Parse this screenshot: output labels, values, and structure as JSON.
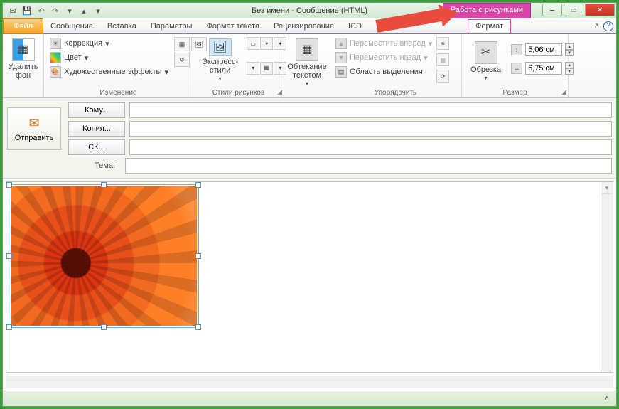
{
  "title": "Без имени  -  Сообщение (HTML)",
  "context_tab": "Работа с рисунками",
  "qat": {
    "icons": [
      "new-mail",
      "save",
      "undo",
      "redo",
      "down",
      "up",
      "more"
    ]
  },
  "win": {
    "min": "–",
    "max": "▭",
    "close": "✕"
  },
  "tabs": {
    "file": "Файл",
    "items": [
      "Сообщение",
      "Вставка",
      "Параметры",
      "Формат текста",
      "Рецензирование",
      "ICD"
    ],
    "format": "Формат",
    "help_chevron": "˄",
    "help_q": "?"
  },
  "ribbon": {
    "remove_bg": {
      "label": "Удалить\nфон"
    },
    "adjust": {
      "corrections": "Коррекция",
      "color": "Цвет",
      "artistic": "Художественные эффекты",
      "group_label": "Изменение"
    },
    "styles": {
      "express": "Экспресс-стили",
      "group_label": "Стили рисунков"
    },
    "wrap": {
      "label": "Обтекание\nтекстом"
    },
    "arrange": {
      "bring_fwd": "Переместить вперед",
      "send_back": "Переместить назад",
      "selection_pane": "Область выделения",
      "group_label": "Упорядочить"
    },
    "crop": {
      "label": "Обрезка"
    },
    "size": {
      "height": "5,06 см",
      "width": "6,75 см",
      "group_label": "Размер"
    }
  },
  "mail": {
    "send": "Отправить",
    "to": "Кому...",
    "cc": "Копия...",
    "bcc": "СК...",
    "subject_label": "Тема:",
    "to_val": "",
    "cc_val": "",
    "bcc_val": "",
    "subject_val": ""
  },
  "status": {
    "chevron": "˄"
  }
}
